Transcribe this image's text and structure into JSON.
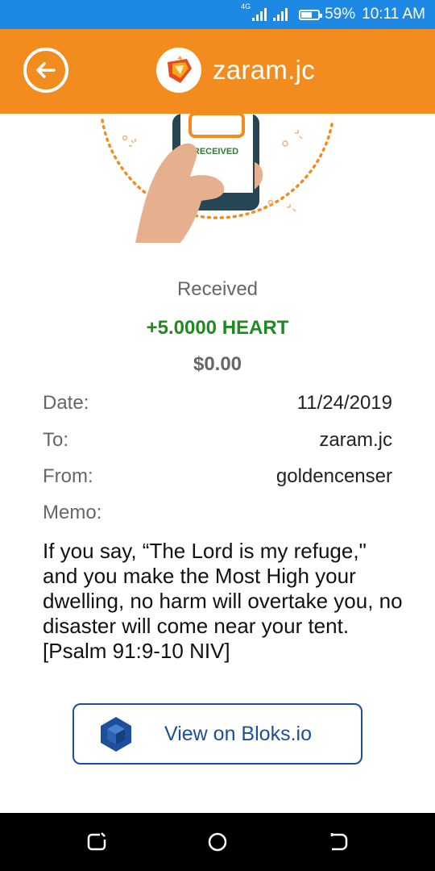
{
  "status_bar": {
    "network": "4G",
    "battery": "59%",
    "time": "10:11 AM"
  },
  "header": {
    "account_name": "zaram.jc"
  },
  "illustration": {
    "phone_label": "RECEIVED"
  },
  "transaction": {
    "status": "Received",
    "amount": "+5.0000 HEART",
    "fiat": "$0.00",
    "date_label": "Date:",
    "date_value": "11/24/2019",
    "to_label": "To:",
    "to_value": "zaram.jc",
    "from_label": "From:",
    "from_value": "goldencenser",
    "memo_label": "Memo:",
    "memo_value": "If you say, “The Lord is my refuge,\" and you make the Most High your dwelling, no harm will overtake you, no disaster will come near your tent. [Psalm 91:9-10 NIV]"
  },
  "actions": {
    "view_label": "View on Bloks.io"
  },
  "colors": {
    "header": "#f28c1e",
    "status_bar": "#1e88e5",
    "amount": "#1f8a1f",
    "button": "#1c4f9c"
  },
  "icons": {
    "back": "back-arrow-icon",
    "brand": "brand-logo-icon",
    "bloks": "cube-icon"
  }
}
